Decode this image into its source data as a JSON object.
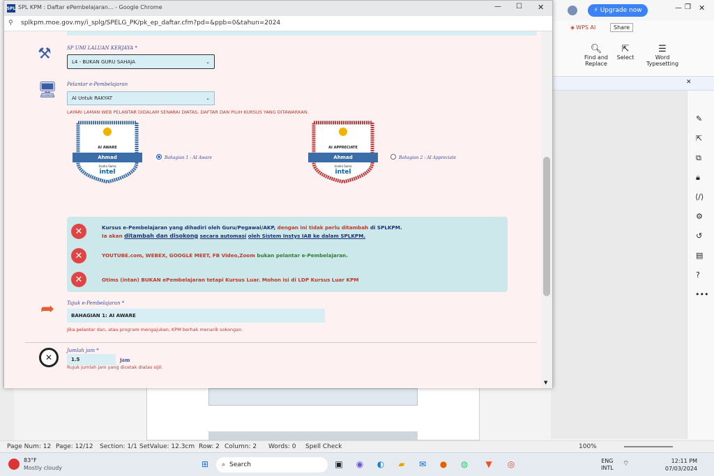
{
  "browser": {
    "tab_title": "SPL KPM : Daftar ePembelajaran... - Google Chrome",
    "url": "splkpm.moe.gov.my/i_splg/SPELG_PK/pk_ep_daftar.cfm?pd=&ppb=0&tahun=2024"
  },
  "form": {
    "job_label": "SP UMI LALUAN KERJAYA *",
    "job_value": "L4 - BUKAN GURU SAHAJA",
    "platform_label": "Pelantar e-Pembelajaran",
    "platform_value": "AI Untuk RAKYAT",
    "instruction": "LAYARI LAMAN WEB PELANTAR DIDALAM SENARAI DIATAS. DAFTAR DAN PILIH KURSUS YANG DITAWARKAN.",
    "badges": [
      {
        "type": "AI AWARE",
        "name": "Ahmad",
        "option": "Bahagian 1 : AI Aware",
        "selected": true,
        "color": "#3b6ea8"
      },
      {
        "type": "AI APPRECIATE",
        "name": "Ahmad",
        "option": "Bahagian 2 : AI Appreciate",
        "selected": false,
        "color": "#c03a3a"
      }
    ],
    "badge_sub": "Usaha Sama",
    "badge_brand": "intel",
    "notices": {
      "n1_a": "Kursus e-Pembelajaran yang dihadiri oleh Guru/Pegawai/AKP,",
      "n1_b": "dengan ini tidak perlu ditambah",
      "n1_c": "di SPLKPM.",
      "n1_line2_a": "Ia akan",
      "n1_line2_b": "ditambah dan disokong",
      "n1_line2_c": "secara automasi",
      "n1_line2_d": "oleh Sistem Instys IAB ke dalam SPLKPM.",
      "n2_a": "YOUTUBE.com, WEBEX, GOOGLE MEET, FB Video,Zoom",
      "n2_b": "bukan pelantar e-Pembelajaran.",
      "n3": "Otims (intan) BUKAN ePembelajaran tetapi Kursus Luar. Mohon isi di LDP Kursus Luar KPM"
    },
    "title_label": "Tajuk e-Pembelajaran *",
    "title_value": "BAHAGIAN 1: AI AWARE",
    "title_note": "Jika pelantar dan, atau program mengajukan, KPM berhak menarik sokongan.",
    "hours_label": "Jumlah jam *",
    "hours_value": "1.5",
    "hours_unit": "jam",
    "hours_note": "Rujuk jumlah jam yang dicetak diatas sijil."
  },
  "wps": {
    "upgrade": "Upgrade now",
    "wps_ai": "WPS AI",
    "share": "Share",
    "find": "Find and Replace",
    "select": "Select",
    "word": "Word",
    "typesetting": "Typesetting"
  },
  "status": {
    "page_num": "Page Num: 12",
    "page": "Page: 12/12",
    "section": "Section: 1/1",
    "setvalue": "SetValue: 12.3cm",
    "row": "Row: 2",
    "column": "Column: 2",
    "words": "Words: 0",
    "spell": "Spell Check",
    "zoom": "100%"
  },
  "taskbar": {
    "temp": "83°F",
    "weather": "Mostly cloudy",
    "search": "Search",
    "lang1": "ENG",
    "lang2": "INTL",
    "time": "12:11 PM",
    "date": "07/03/2024"
  }
}
